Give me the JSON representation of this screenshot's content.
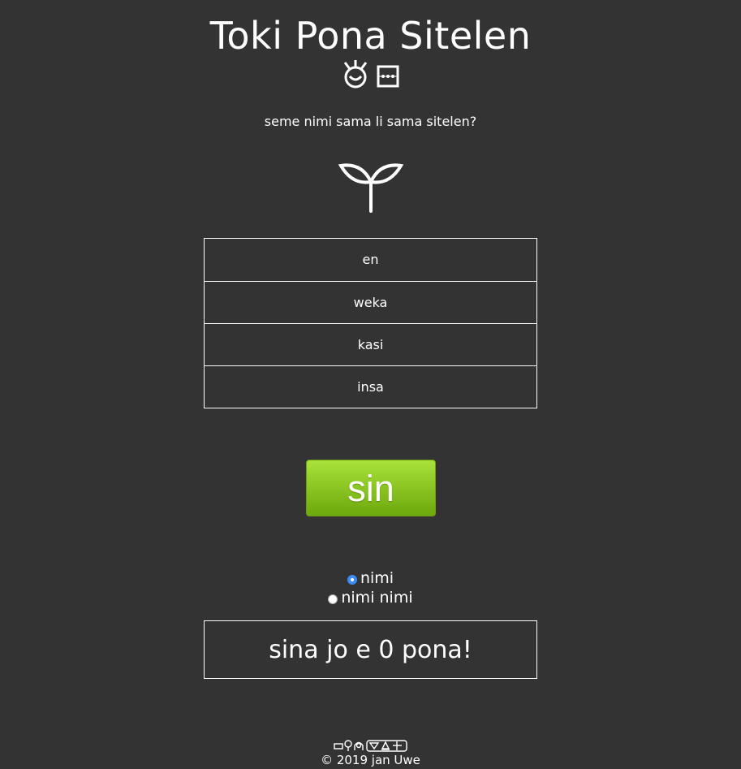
{
  "header": {
    "title": "Toki Pona Sitelen",
    "title_glyphs": [
      "suno-icon",
      "lipu-icon"
    ]
  },
  "question": {
    "prompt": "seme nimi sama li sama sitelen?",
    "glyph_icon": "kasi-icon"
  },
  "options": [
    {
      "label": "en"
    },
    {
      "label": "weka"
    },
    {
      "label": "kasi"
    },
    {
      "label": "insa"
    }
  ],
  "submit": {
    "label": "sin",
    "color_top": "#a9e23a",
    "color_bottom": "#6da80d"
  },
  "mode": {
    "options": [
      {
        "label": "nimi",
        "checked": true
      },
      {
        "label": "nimi nimi",
        "checked": false
      }
    ]
  },
  "score": {
    "text": "sina jo e 0 pona!"
  },
  "footer": {
    "signature_glyphs": "jan Uwe name glyphs",
    "copyright": "© 2019 jan Uwe"
  }
}
